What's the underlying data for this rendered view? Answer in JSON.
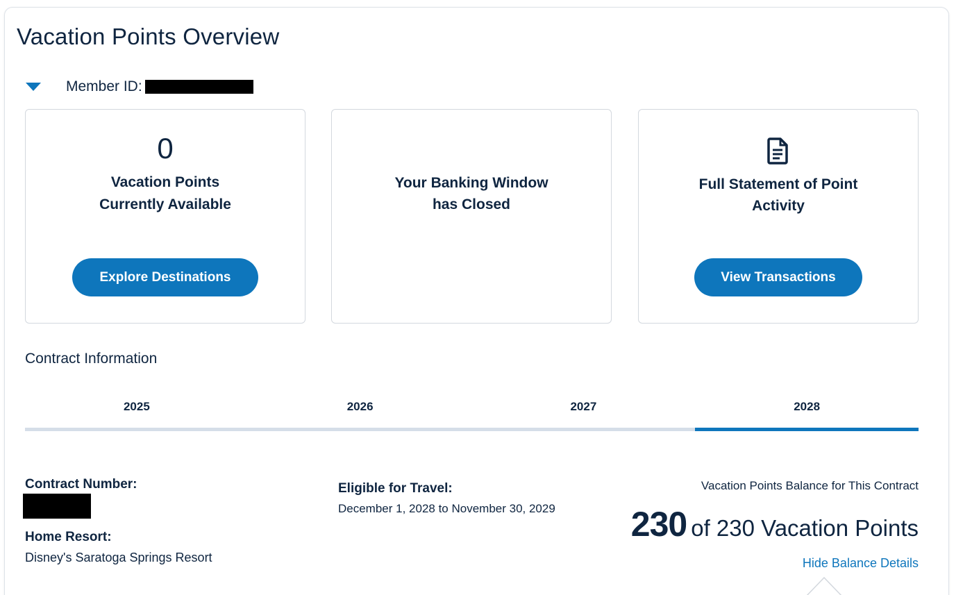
{
  "page": {
    "title": "Vacation Points Overview"
  },
  "member": {
    "label": "Member ID:",
    "id_redacted": true
  },
  "cards": {
    "points": {
      "value": "0",
      "line1": "Vacation Points",
      "line2": "Currently Available",
      "button": "Explore Destinations"
    },
    "banking": {
      "line1": "Your Banking Window",
      "line2": "has Closed"
    },
    "statement": {
      "icon": "document-icon",
      "line1": "Full Statement of Point",
      "line2": "Activity",
      "button": "View Transactions"
    }
  },
  "contract": {
    "heading": "Contract Information",
    "tabs": [
      {
        "label": "2025"
      },
      {
        "label": "2026"
      },
      {
        "label": "2027"
      },
      {
        "label": "2028"
      }
    ],
    "active_tab": "2028",
    "number_label": "Contract Number:",
    "home_resort_label": "Home Resort:",
    "home_resort_value": "Disney's Saratoga Springs Resort",
    "eligible_label": "Eligible for Travel:",
    "eligible_value": "December 1, 2028 to November 30, 2029",
    "balance_label": "Vacation Points Balance for This Contract",
    "balance_value": "230",
    "balance_suffix": "of 230 Vacation Points",
    "hide_link": "Hide Balance Details"
  },
  "colors": {
    "accent": "#0e76bc",
    "text": "#0f2540",
    "tab_track": "#d5dee8",
    "card_border": "#d3d8de"
  }
}
